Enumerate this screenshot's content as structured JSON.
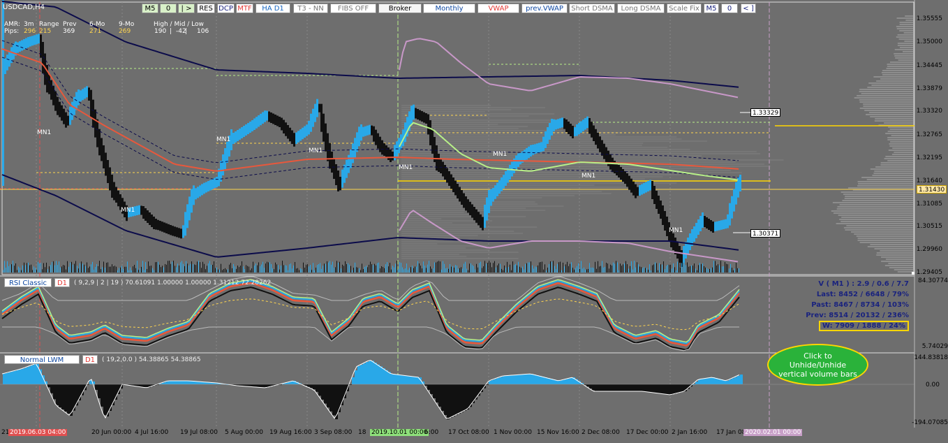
{
  "symbol_title": "USDCAD,H4",
  "toolbar": [
    {
      "label": "M5",
      "color": "#000000",
      "bg": "#d8f0c8"
    },
    {
      "label": "0",
      "color": "#000000",
      "bg": "#d8f0c8"
    },
    {
      "label": "| >",
      "color": "#000000",
      "bg": "#d8f0c8"
    },
    {
      "label": "RES",
      "color": "#000000",
      "bg": "#ffffff"
    },
    {
      "label": "DCP",
      "color": "#1a237e",
      "bg": "#ffffff"
    },
    {
      "label": "MTF",
      "color": "#e53935",
      "bg": "#ffffff"
    },
    {
      "label": "HA D1",
      "color": "#1565c0",
      "bg": "#ffffff"
    },
    {
      "label": "T3 - NN",
      "color": "#757575",
      "bg": "#ffffff"
    },
    {
      "label": "FIBS OFF",
      "color": "#757575",
      "bg": "#ffffff"
    },
    {
      "label": "Broker",
      "color": "#000000",
      "bg": "#f5f5f5"
    },
    {
      "label": "Monthly",
      "color": "#0d47a1",
      "bg": "#ffffff"
    },
    {
      "label": "VWAP",
      "color": "#e53935",
      "bg": "#ffffff"
    },
    {
      "label": "prev.VWAP",
      "color": "#0d47a1",
      "bg": "#ffffff"
    },
    {
      "label": "Short DSMA",
      "color": "#757575",
      "bg": "#ffffff"
    },
    {
      "label": "Long DSMA",
      "color": "#757575",
      "bg": "#ffffff"
    },
    {
      "label": "Scale Fix",
      "color": "#757575",
      "bg": "#ffffff"
    },
    {
      "label": "M5",
      "color": "#1a237e",
      "bg": "#ffffff"
    },
    {
      "label": "0",
      "color": "#1a237e",
      "bg": "#ffffff"
    },
    {
      "label": "< ]",
      "color": "#1a237e",
      "bg": "#ffffff"
    }
  ],
  "amr": {
    "amr_label": "AMR:",
    "pips_label": "Pips:",
    "cols": [
      {
        "head": "3m",
        "val": "296",
        "color": "#ffd54f"
      },
      {
        "head": "Range",
        "val": "215",
        "color": "#ffd54f"
      },
      {
        "head": "Prev",
        "val": "369",
        "color": "#ffffff"
      },
      {
        "head": "6-Mo",
        "val": "271",
        "color": "#ffd54f"
      },
      {
        "head": "9-Mo",
        "val": "269",
        "color": "#ffd54f"
      }
    ],
    "hml_head": "High / Mid / Low",
    "hml_vals": [
      "190",
      "|",
      "-42",
      "|",
      "106"
    ]
  },
  "price_axis": [
    "1.35555",
    "1.35000",
    "1.34445",
    "1.33879",
    "1.33320",
    "1.32765",
    "1.32195",
    "1.31640",
    "1.31085",
    "1.30515",
    "1.29960",
    "1.29405"
  ],
  "price_boxes": {
    "level_high": "1.33329",
    "current": "1.31430",
    "level_low": "1.30371"
  },
  "mn1_labels": [
    "MN1",
    "MN1",
    "MN1",
    "MN1",
    "MN1",
    "MN1",
    "MN1"
  ],
  "rsi": {
    "name": "RSI Classic",
    "tf": "D1",
    "params": "( 9,2,9 | 2 | 19 ) 70.61091 1.00000 1.00000 1.31212 72.28262",
    "axis_top": "84.30774",
    "axis_bottom": "5.74029"
  },
  "volume_stats": {
    "title": "V ( M1 ) : 2.9 / 0.6 / 7.7",
    "last": "Last: 8452 / 6648 / 79%",
    "past": "Past: 8467 / 8734 / 103%",
    "prev": "Prev: 8514 / 20132 / 236%",
    "w": "W: 7909 / 1888 / 24%"
  },
  "callout": "Click to Unhide/Unhide vertical volume bars",
  "lwm": {
    "name": "Normal LWM",
    "tf": "D1",
    "params": "( 19,2,0.0 ) 54.38865 54.38865",
    "axis_top": "144.83818",
    "axis_mid": "0.00",
    "axis_bottom": "-194.07085"
  },
  "time_axis": [
    "21",
    "2019.06.03 04:00",
    "20 Jun 00:00",
    "4 Jul 16:00",
    "19 Jul 08:00",
    "5 Aug 00:00",
    "19 Aug 16:00",
    "3 Sep 08:00",
    "18",
    "2019.10.01 00:00",
    "6:00",
    "17 Oct 08:00",
    "1 Nov 00:00",
    "15 Nov 16:00",
    "2 Dec 08:00",
    "17 Dec 00:00",
    "2 Jan 16:00",
    "17 Jan 08:00",
    "2020.02.01 00:00"
  ],
  "colors": {
    "bg": "#6e6e6e",
    "up": "#29a8e8",
    "down": "#111111",
    "vwap": "#e8583c",
    "band": "#0b0b4a",
    "pink": "#c898c8",
    "green": "#b8f088"
  }
}
